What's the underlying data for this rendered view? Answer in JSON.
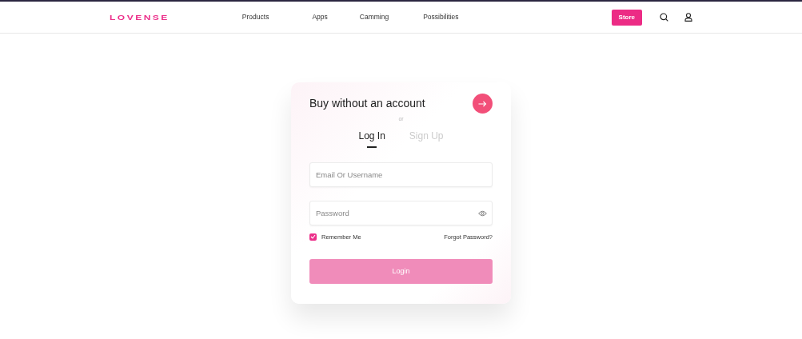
{
  "header": {
    "logo": "LOVENSE",
    "links": [
      "Products",
      "Apps",
      "Camming",
      "Possibilities"
    ],
    "store_button": "Store"
  },
  "card": {
    "guest_title": "Buy without an account",
    "separator": "or",
    "tabs": [
      {
        "label": "Log In",
        "selected": true
      },
      {
        "label": "Sign Up",
        "selected": false
      }
    ],
    "fields": [
      {
        "kind": "text",
        "placeholder": "Email Or Username"
      },
      {
        "kind": "password",
        "placeholder": "Password"
      }
    ],
    "remember": {
      "label": "Remember Me",
      "checked": true
    },
    "forgot_link": "Forgot Password?",
    "login_button": {
      "label": "Login",
      "disabled": true
    }
  }
}
